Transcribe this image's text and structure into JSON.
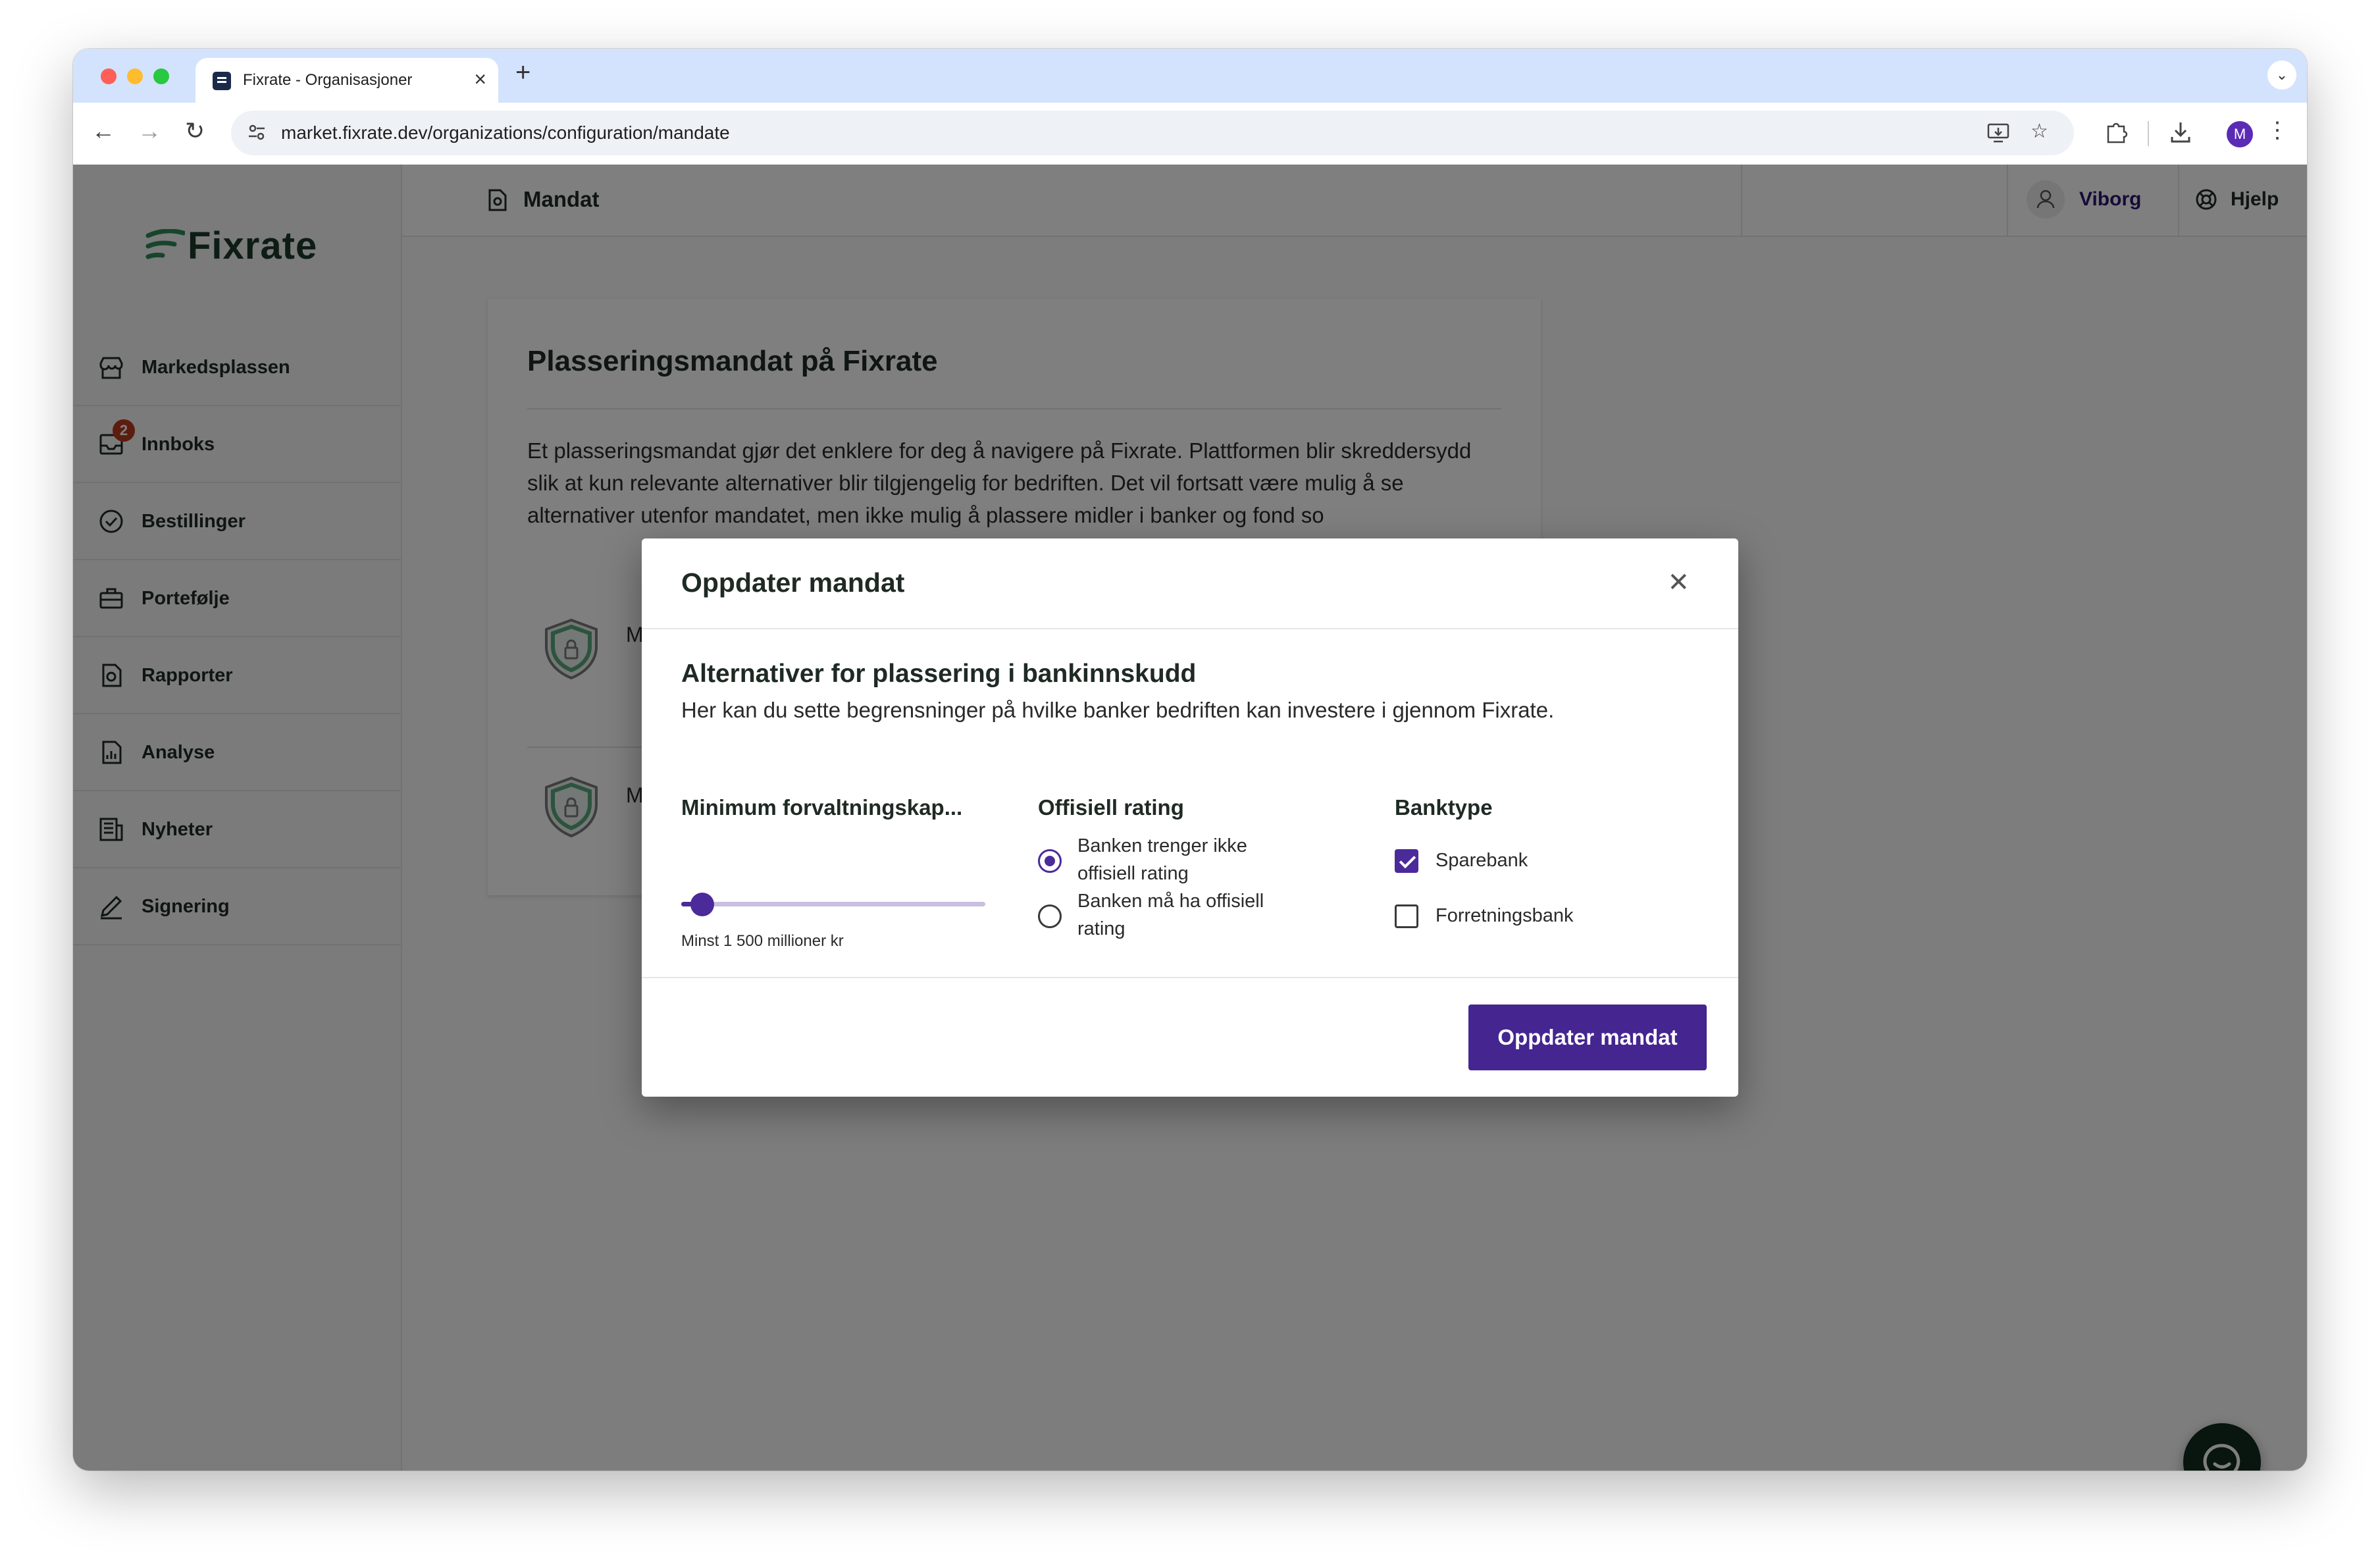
{
  "browser": {
    "tab_title": "Fixrate - Organisasjoner",
    "url": "market.fixrate.dev/organizations/configuration/mandate",
    "profile_initial": "M"
  },
  "sidebar": {
    "logo_text": "Fixrate",
    "items": [
      {
        "label": "Markedsplassen",
        "icon": "store-icon"
      },
      {
        "label": "Innboks",
        "icon": "inbox-icon",
        "badge": "2"
      },
      {
        "label": "Bestillinger",
        "icon": "check-circle-icon"
      },
      {
        "label": "Portefølje",
        "icon": "briefcase-icon"
      },
      {
        "label": "Rapporter",
        "icon": "report-icon"
      },
      {
        "label": "Analyse",
        "icon": "chart-icon"
      },
      {
        "label": "Nyheter",
        "icon": "news-icon"
      },
      {
        "label": "Signering",
        "icon": "signature-icon"
      }
    ]
  },
  "topbar": {
    "title": "Mandat",
    "user": "Viborg",
    "help": "Hjelp"
  },
  "page": {
    "title": "Plasseringsmandat på Fixrate",
    "paragraph": "Et plasseringsmandat gjør det enklere for deg å navigere på Fixrate. Plattformen blir skreddersydd slik at kun relevante alternativer blir tilgjengelig for bedriften. Det vil fortsatt være mulig å se alternativer utenfor mandatet, men ikke mulig å plassere midler i banker og fond so",
    "row_letter_1": "M",
    "row_letter_2": "M"
  },
  "modal": {
    "title": "Oppdater mandat",
    "subtitle": "Alternativer for plassering i bankinnskudd",
    "description": "Her kan du sette begrensninger på hvilke banker bedriften kan investere i gjennom Fixrate.",
    "capital": {
      "title": "Minimum forvaltningskap...",
      "caption": "Minst 1 500 millioner kr",
      "slider_fraction": 0.07
    },
    "rating": {
      "title": "Offisiell rating",
      "options": [
        {
          "label_line1": "Banken trenger ikke",
          "label_line2": "offisiell rating",
          "selected": true
        },
        {
          "label_line1": "Banken må ha offisiell",
          "label_line2": "rating",
          "selected": false
        }
      ]
    },
    "banktype": {
      "title": "Banktype",
      "options": [
        {
          "label": "Sparebank",
          "checked": true
        },
        {
          "label": "Forretningsbank",
          "checked": false
        }
      ]
    },
    "submit_label": "Oppdater mandat"
  },
  "colors": {
    "accent": "#45258f",
    "brand_green": "#1b3a2c",
    "badge": "#b83b1d"
  }
}
